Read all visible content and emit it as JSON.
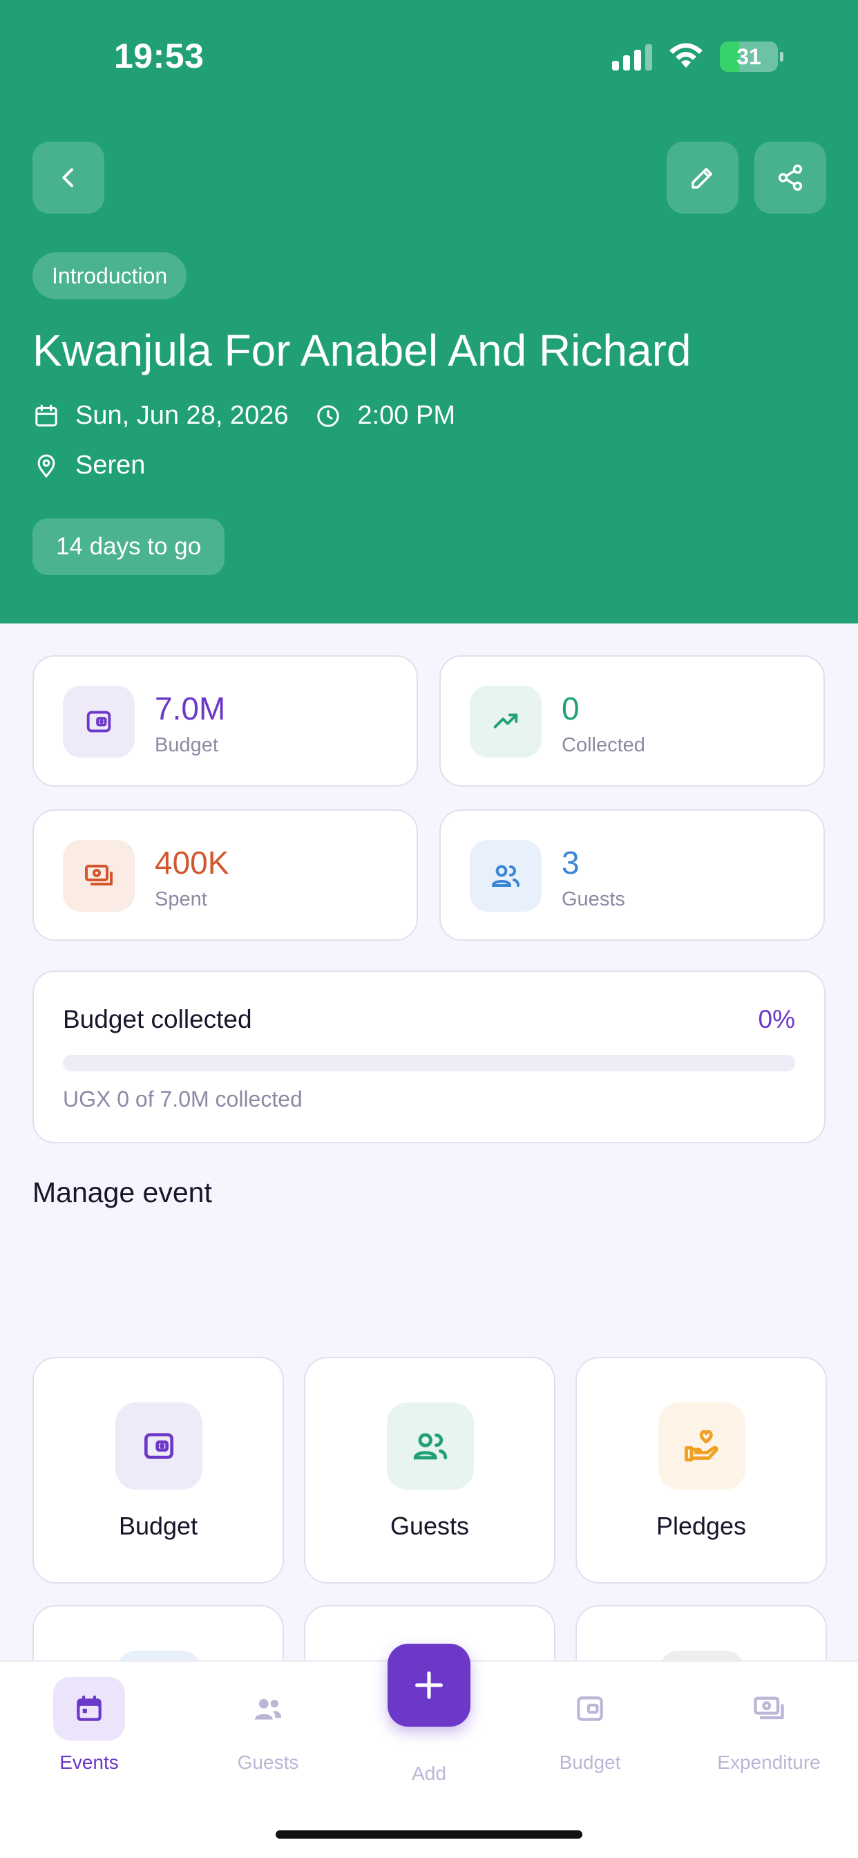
{
  "status_bar": {
    "time": "19:53",
    "battery": "31"
  },
  "event": {
    "tag": "Introduction",
    "title": "Kwanjula For Anabel And Richard",
    "date": "Sun, Jun 28, 2026",
    "time": "2:00 PM",
    "location": "Seren",
    "countdown": "14 days to go"
  },
  "stats": {
    "budget": {
      "value": "7.0M",
      "label": "Budget",
      "color": "#6c38c8"
    },
    "collected": {
      "value": "0",
      "label": "Collected",
      "color": "#20a074"
    },
    "spent": {
      "value": "400K",
      "label": "Spent",
      "color": "#d2572e"
    },
    "guests": {
      "value": "3",
      "label": "Guests",
      "color": "#3a86d4"
    }
  },
  "budget_progress": {
    "title": "Budget collected",
    "percent": "0%",
    "fraction": 0,
    "detail": "UGX 0 of 7.0M collected"
  },
  "manage": {
    "title": "Manage event",
    "tiles": [
      {
        "label": "Budget",
        "icon": "wallet-icon"
      },
      {
        "label": "Guests",
        "icon": "users-icon"
      },
      {
        "label": "Pledges",
        "icon": "hand-heart-icon"
      }
    ]
  },
  "tabbar": {
    "items": [
      {
        "label": "Events",
        "icon": "calendar-icon",
        "active": true
      },
      {
        "label": "Guests",
        "icon": "users-icon"
      },
      {
        "label": "Add",
        "icon": "plus-icon"
      },
      {
        "label": "Budget",
        "icon": "wallet-icon"
      },
      {
        "label": "Expenditure",
        "icon": "cash-icon"
      }
    ]
  },
  "colors": {
    "hero": "#20a074",
    "accent": "#6c38c8",
    "background": "#f6f5fe"
  }
}
